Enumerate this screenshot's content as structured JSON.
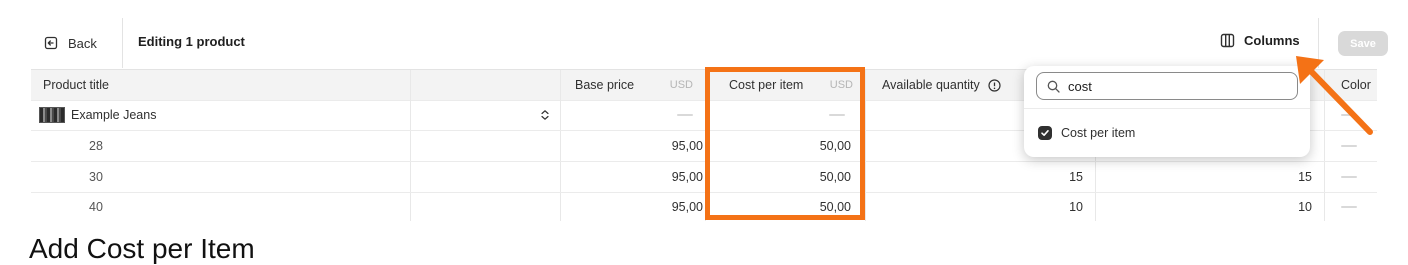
{
  "toolbar": {
    "back_label": "Back",
    "title": "Editing 1 product",
    "columns_label": "Columns",
    "save_label": "Save"
  },
  "table": {
    "headers": {
      "product_title": "Product title",
      "base_price": "Base price",
      "base_price_unit": "USD",
      "cost_per_item": "Cost per item",
      "cost_per_item_unit": "USD",
      "available_quantity": "Available quantity",
      "color": "Color"
    },
    "product": {
      "name": "Example Jeans"
    },
    "variants": [
      {
        "name": "28",
        "base_price": "95,00",
        "cost": "50,00",
        "qty_a": "",
        "qty_b": ""
      },
      {
        "name": "30",
        "base_price": "95,00",
        "cost": "50,00",
        "qty_a": "15",
        "qty_b": "15"
      },
      {
        "name": "40",
        "base_price": "95,00",
        "cost": "50,00",
        "qty_a": "10",
        "qty_b": "10"
      }
    ]
  },
  "columns_popover": {
    "search_value": "cost",
    "option_label": "Cost per item",
    "option_checked": true
  },
  "annotation": {
    "caption": "Add Cost per Item",
    "highlight_color": "#f47216"
  }
}
